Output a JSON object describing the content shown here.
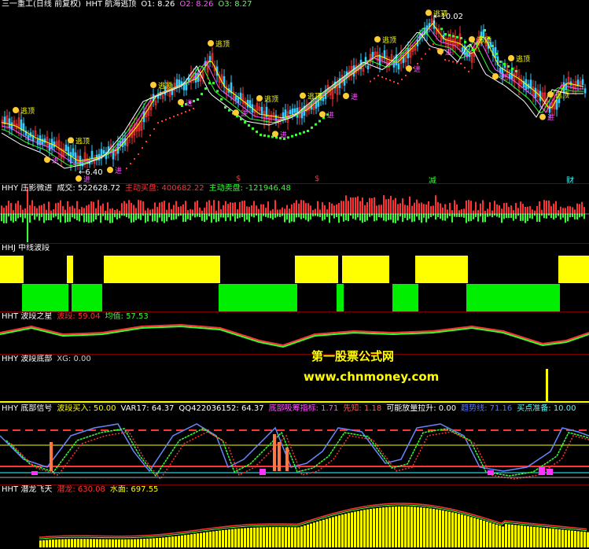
{
  "main": {
    "labels": [
      {
        "text": "三一重工(日线 前复权)",
        "color": "#ffffff"
      },
      {
        "text": "HHT 航海逃顶",
        "color": "#ffffff"
      },
      {
        "text": "O1: 8.26",
        "color": "#ffffff"
      },
      {
        "text": "O2: 8.26",
        "color": "#ff55ff"
      },
      {
        "text": "O3: 8.27",
        "color": "#55ff55"
      }
    ],
    "high_label": "10.02",
    "low_label": "6.40",
    "marker_top": "逃顶",
    "marker_bottom": "进",
    "markers": [
      "$",
      "$",
      "减",
      "财"
    ]
  },
  "vol": {
    "labels": [
      {
        "text": "HHY 庄影微进",
        "color": "#ffffff"
      },
      {
        "text": "成交: 522628.72",
        "color": "#ffffff"
      },
      {
        "text": "主动买盘: 400682.22",
        "color": "#ff3333"
      },
      {
        "text": "主动卖盘: -121946.48",
        "color": "#33ff33"
      }
    ]
  },
  "wave": {
    "labels": [
      {
        "text": "HHJ 中线波段",
        "color": "#ffffff"
      }
    ]
  },
  "star": {
    "labels": [
      {
        "text": "HHT 波段之星",
        "color": "#ffffff"
      },
      {
        "text": "波段: 59.04",
        "color": "#ff3333"
      },
      {
        "text": "均值: 57.53",
        "color": "#33ff33"
      }
    ]
  },
  "bottom": {
    "labels": [
      {
        "text": "HHY 波段底部",
        "color": "#ffffff"
      },
      {
        "text": "XG: 0.00",
        "color": "#cccccc"
      }
    ]
  },
  "watermark": {
    "line1": "第一股票公式网",
    "line2": "www.chnmoney.com"
  },
  "signal": {
    "labels": [
      {
        "text": "HHY 底部信号",
        "color": "#ffffff"
      },
      {
        "text": "波段买入: 50.00",
        "color": "#ffff00"
      },
      {
        "text": "VAR17: 64.37",
        "color": "#ffffff"
      },
      {
        "text": "QQ422036152: 64.37",
        "color": "#ffffff"
      },
      {
        "text": "底部吸筹指标: 1.71",
        "color": "#ff55ff"
      },
      {
        "text": "先知: 1.18",
        "color": "#ff5555"
      },
      {
        "text": "可能放量拉升: 0.00",
        "color": "#ffffff"
      },
      {
        "text": "趋势线: 71.16",
        "color": "#5577ff"
      },
      {
        "text": "买点准备: 10.00",
        "color": "#55ffff"
      }
    ]
  },
  "dragon": {
    "labels": [
      {
        "text": "HHT 潜龙飞天",
        "color": "#ffffff"
      },
      {
        "text": "潜龙: 630.08",
        "color": "#ff3333"
      },
      {
        "text": "水面: 697.55",
        "color": "#ffff00"
      }
    ]
  }
}
